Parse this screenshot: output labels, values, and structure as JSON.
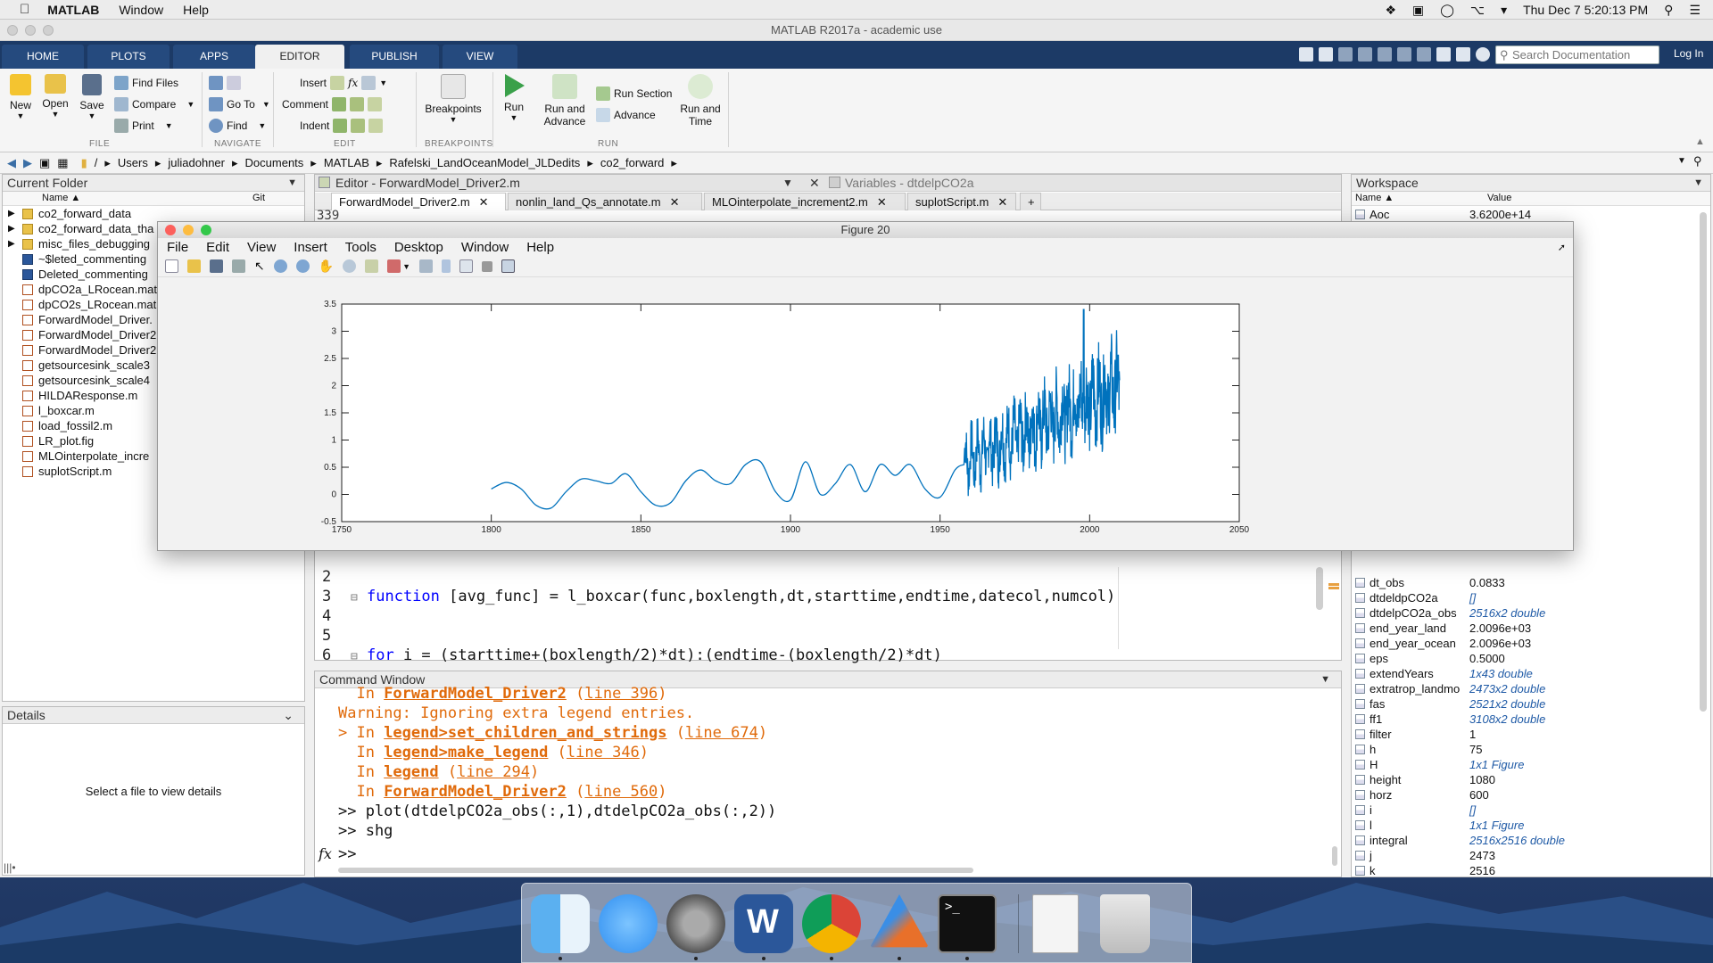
{
  "menubar": {
    "app": "MATLAB",
    "items": [
      "Window",
      "Help"
    ],
    "clock": "Thu Dec 7  5:20:13 PM"
  },
  "window": {
    "title": "MATLAB R2017a - academic use"
  },
  "ribbon": {
    "tabs": [
      "HOME",
      "PLOTS",
      "APPS",
      "EDITOR",
      "PUBLISH",
      "VIEW"
    ],
    "search_placeholder": "Search Documentation",
    "login": "Log In",
    "file": {
      "new": "New",
      "open": "Open",
      "save": "Save",
      "find_files": "Find Files",
      "compare": "Compare",
      "print": "Print",
      "label": "FILE"
    },
    "navigate": {
      "go_to": "Go To",
      "find": "Find",
      "label": "NAVIGATE"
    },
    "edit": {
      "insert": "Insert",
      "comment": "Comment",
      "indent": "Indent",
      "label": "EDIT",
      "fx": "fx"
    },
    "breakpoints": {
      "button": "Breakpoints",
      "label": "BREAKPOINTS"
    },
    "run": {
      "run": "Run",
      "run_and_advance_1": "Run and",
      "run_and_advance_2": "Advance",
      "run_section": "Run Section",
      "advance": "Advance",
      "run_and_time_1": "Run and",
      "run_and_time_2": "Time",
      "label": "RUN"
    }
  },
  "address": {
    "root": "/",
    "parts": [
      "Users",
      "juliadohner",
      "Documents",
      "MATLAB",
      "Rafelski_LandOceanModel_JLDedits",
      "co2_forward"
    ]
  },
  "current_folder": {
    "title": "Current Folder",
    "col_name": "Name ▲",
    "col_git": "Git",
    "items": [
      {
        "name": "co2_forward_data",
        "type": "folder"
      },
      {
        "name": "co2_forward_data_tha",
        "type": "folder"
      },
      {
        "name": "misc_files_debugging",
        "type": "folder"
      },
      {
        "name": "~$leted_commenting",
        "type": "doc"
      },
      {
        "name": "Deleted_commenting",
        "type": "doc"
      },
      {
        "name": "dpCO2a_LRocean.mat",
        "type": "mat"
      },
      {
        "name": "dpCO2s_LRocean.mat",
        "type": "mat"
      },
      {
        "name": "ForwardModel_Driver.",
        "type": "m"
      },
      {
        "name": "ForwardModel_Driver2",
        "type": "m"
      },
      {
        "name": "ForwardModel_Driver2",
        "type": "m"
      },
      {
        "name": "getsourcesink_scale3",
        "type": "m"
      },
      {
        "name": "getsourcesink_scale4",
        "type": "m"
      },
      {
        "name": "HILDAResponse.m",
        "type": "m"
      },
      {
        "name": "l_boxcar.m",
        "type": "m"
      },
      {
        "name": "load_fossil2.m",
        "type": "m"
      },
      {
        "name": "LR_plot.fig",
        "type": "fig"
      },
      {
        "name": "MLOinterpolate_incre",
        "type": "m"
      },
      {
        "name": "suplotScript.m",
        "type": "m"
      }
    ]
  },
  "details": {
    "title": "Details",
    "empty_text": "Select a file to view details"
  },
  "editor": {
    "title": "Editor - ForwardModel_Driver2.m",
    "variables_title": "Variables - dtdelpCO2a",
    "tabs": [
      "ForwardModel_Driver2.m",
      "nonlin_land_Qs_annotate.m",
      "MLOinterpolate_increment2.m",
      "suplotScript.m"
    ],
    "add_tab": "+",
    "lines": [
      {
        "num": "2",
        "text": ""
      },
      {
        "num": "3",
        "text": "function [avg_func] = l_boxcar(func,boxlength,dt,starttime,endtime,datecol,numcol)",
        "keyword": "function"
      },
      {
        "num": "4",
        "text": ""
      },
      {
        "num": "5",
        "text": ""
      },
      {
        "num": "6",
        "text": "for i = (starttime+(boxlength/2)*dt):(endtime-(boxlength/2)*dt)",
        "keyword": "for"
      }
    ],
    "top_line_num": "339"
  },
  "command_window": {
    "title": "Command Window",
    "lines": [
      {
        "kind": "err",
        "prefix": "  In ",
        "link": "ForwardModel_Driver2",
        "suffix": " (",
        "line": "line 396",
        "end": ")"
      },
      {
        "kind": "warn",
        "text": "Warning: Ignoring extra legend entries."
      },
      {
        "kind": "err",
        "prefix": "> In ",
        "link": "legend>set_children_and_strings",
        "suffix": " (",
        "line": "line 674",
        "end": ")"
      },
      {
        "kind": "err",
        "prefix": "  In ",
        "link": "legend>make_legend",
        "suffix": " (",
        "line": "line 346",
        "end": ")"
      },
      {
        "kind": "err",
        "prefix": "  In ",
        "link": "legend",
        "suffix": " (",
        "line": "line 294",
        "end": ")"
      },
      {
        "kind": "err",
        "prefix": "  In ",
        "link": "ForwardModel_Driver2",
        "suffix": " (",
        "line": "line 560",
        "end": ")"
      },
      {
        "kind": "cmd",
        "text": ">> plot(dtdelpCO2a_obs(:,1),dtdelpCO2a_obs(:,2))"
      },
      {
        "kind": "cmd",
        "text": ">> shg"
      }
    ],
    "prompt": ">>",
    "fx": "fx"
  },
  "workspace": {
    "title": "Workspace",
    "col_name": "Name ▲",
    "col_value": "Value",
    "top_items": [
      {
        "name": "Aoc",
        "value": "3.6200e+14",
        "italic": false
      }
    ],
    "items": [
      {
        "name": "dt_obs",
        "value": "0.0833",
        "italic": false
      },
      {
        "name": "dtdeldpCO2a",
        "value": "[]",
        "italic": true
      },
      {
        "name": "dtdelpCO2a_obs",
        "value": "2516x2 double",
        "italic": true
      },
      {
        "name": "end_year_land",
        "value": "2.0096e+03",
        "italic": false
      },
      {
        "name": "end_year_ocean",
        "value": "2.0096e+03",
        "italic": false
      },
      {
        "name": "eps",
        "value": "0.5000",
        "italic": false
      },
      {
        "name": "extendYears",
        "value": "1x43 double",
        "italic": true
      },
      {
        "name": "extratrop_landmo",
        "value": "2473x2 double",
        "italic": true
      },
      {
        "name": "fas",
        "value": "2521x2 double",
        "italic": true
      },
      {
        "name": "ff1",
        "value": "3108x2 double",
        "italic": true
      },
      {
        "name": "filter",
        "value": "1",
        "italic": false
      },
      {
        "name": "h",
        "value": "75",
        "italic": false
      },
      {
        "name": "H",
        "value": "1x1 Figure",
        "italic": true
      },
      {
        "name": "height",
        "value": "1080",
        "italic": false
      },
      {
        "name": "horz",
        "value": "600",
        "italic": false
      },
      {
        "name": "i",
        "value": "[]",
        "italic": true
      },
      {
        "name": "l",
        "value": "1x1 Figure",
        "italic": true
      },
      {
        "name": "integral",
        "value": "2516x2516 double",
        "italic": true
      },
      {
        "name": "j",
        "value": "2473",
        "italic": false
      },
      {
        "name": "k",
        "value": "2516",
        "italic": false
      }
    ]
  },
  "figure": {
    "title": "Figure 20",
    "menu": [
      "File",
      "Edit",
      "View",
      "Insert",
      "Tools",
      "Desktop",
      "Window",
      "Help"
    ]
  },
  "chart_data": {
    "type": "line",
    "xlim": [
      1750,
      2050
    ],
    "ylim": [
      -0.5,
      3.5
    ],
    "xticks": [
      1750,
      1800,
      1850,
      1900,
      1950,
      2000,
      2050
    ],
    "yticks": [
      -0.5,
      0,
      0.5,
      1,
      1.5,
      2,
      2.5,
      3,
      3.5
    ],
    "xtick_labels": [
      "1750",
      "1800",
      "1850",
      "1900",
      "1950",
      "2000",
      "2050"
    ],
    "ytick_labels": [
      "-0.5",
      "0",
      "0.5",
      "1",
      "1.5",
      "2",
      "2.5",
      "3",
      "3.5"
    ],
    "color": "#0072bd",
    "grid": false,
    "smooth_x": [
      1800,
      1805,
      1810,
      1815,
      1820,
      1825,
      1830,
      1835,
      1840,
      1845,
      1850,
      1855,
      1860,
      1865,
      1870,
      1875,
      1880,
      1885,
      1890,
      1895,
      1900,
      1905,
      1910,
      1915,
      1920,
      1925,
      1930,
      1935,
      1940,
      1945,
      1950,
      1955,
      1958
    ],
    "smooth_y": [
      0.1,
      0.22,
      0.1,
      -0.2,
      -0.25,
      0.05,
      0.28,
      0.25,
      0.2,
      0.38,
      0.05,
      -0.2,
      -0.15,
      0.25,
      0.45,
      0.25,
      0.2,
      0.55,
      0.6,
      0.05,
      -0.1,
      0.6,
      0.0,
      0.2,
      0.55,
      0.05,
      0.55,
      0.35,
      0.55,
      0.1,
      -0.05,
      0.45,
      0.55
    ],
    "noisy_start": 1958,
    "noisy_end": 2010,
    "noisy_trend_start": 0.6,
    "noisy_trend_end": 2.0,
    "noisy_amplitude": 0.65,
    "peak": {
      "x": 1998,
      "y": 3.4
    }
  },
  "dock": {
    "apps": [
      "Finder",
      "Messages",
      "System Preferences",
      "Word",
      "Chrome",
      "MATLAB",
      "Terminal",
      "Document",
      "Trash"
    ]
  }
}
